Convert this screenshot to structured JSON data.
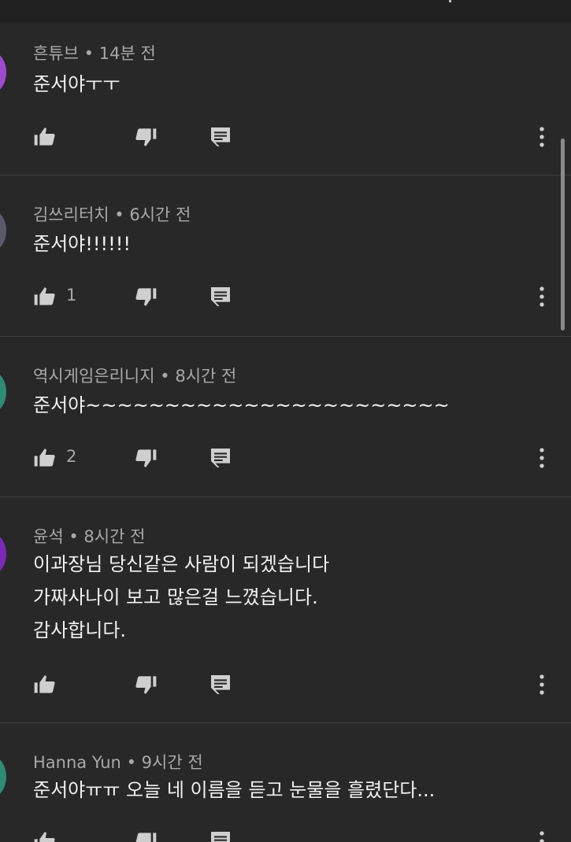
{
  "comments": [
    {
      "author": "흔튜브",
      "time": "14분 전",
      "lines": [
        "준서야ㅜㅜ"
      ],
      "likes": "",
      "avatar_color": "#9c4bd1"
    },
    {
      "author": "김쓰리터치",
      "time": "6시간 전",
      "lines": [
        "준서야!!!!!!"
      ],
      "likes": "1",
      "avatar_color": "#5a5a6a"
    },
    {
      "author": "역시게임은리니지",
      "time": "8시간 전",
      "lines": [
        "준서야~~~~~~~~~~~~~~~~~~~~~~~"
      ],
      "likes": "2",
      "avatar_color": "#2e8b75"
    },
    {
      "author": "윤석",
      "time": "8시간 전",
      "lines": [
        "이과장님 당신같은 사람이 되겠습니다",
        "가짜사나이 보고 많은걸 느꼈습니다.",
        "감사합니다."
      ],
      "likes": "",
      "avatar_color": "#7b2ab8"
    },
    {
      "author": "Hanna Yun",
      "time": "9시간 전",
      "lines": [
        "준서야ㅠㅠ 오늘 네 이름을 듣고 눈물을 흘렸단다..."
      ],
      "likes": "",
      "avatar_color": "#2e8b75"
    }
  ],
  "separator": "•",
  "icons": {
    "like": "thumb-up-icon",
    "dislike": "thumb-down-icon",
    "reply": "comment-icon",
    "more": "more-vertical-icon"
  }
}
